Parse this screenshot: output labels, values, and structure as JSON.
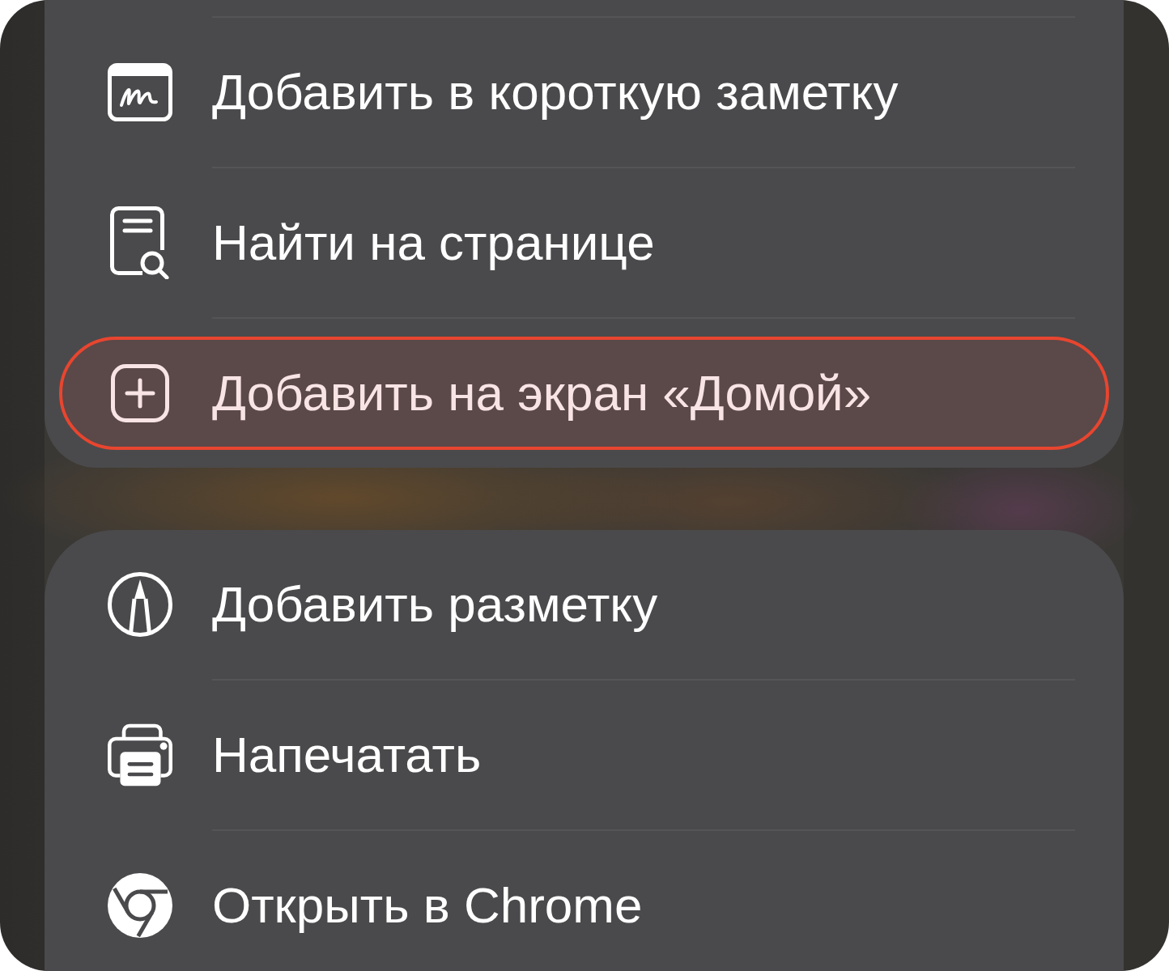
{
  "groups": [
    {
      "items": [
        {
          "label": "Добавить в короткую заметку",
          "selected": false
        },
        {
          "label": "Найти на странице",
          "selected": false
        },
        {
          "label": "Добавить на экран «Домой»",
          "selected": true
        }
      ]
    },
    {
      "items": [
        {
          "label": "Добавить разметку",
          "selected": false
        },
        {
          "label": "Напечатать",
          "selected": false
        },
        {
          "label": "Открыть в Chrome",
          "selected": false
        }
      ]
    }
  ]
}
